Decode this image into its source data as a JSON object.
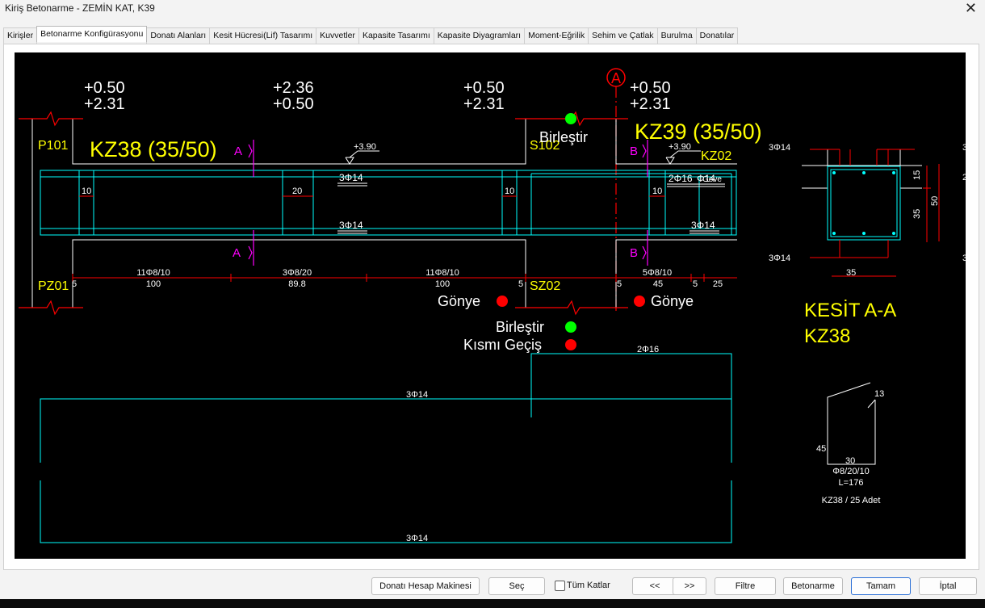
{
  "window": {
    "title": "Kiriş Betonarme - ZEMİN KAT, K39",
    "close": "✕"
  },
  "tabs": [
    {
      "label": "Kirişler"
    },
    {
      "label": "Betonarme Konfigürasyonu",
      "active": true
    },
    {
      "label": "Donatı Alanları"
    },
    {
      "label": "Kesit Hücresi(Lif) Tasarımı"
    },
    {
      "label": "Kuvvetler"
    },
    {
      "label": "Kapasite Tasarımı"
    },
    {
      "label": "Kapasite Diyagramları"
    },
    {
      "label": "Moment-Eğrilik"
    },
    {
      "label": "Sehim ve Çatlak"
    },
    {
      "label": "Burulma"
    },
    {
      "label": "Donatılar"
    }
  ],
  "drawing": {
    "elev_left": [
      "+0.50",
      "+2.31"
    ],
    "elev_mid": [
      "+2.36",
      "+0.50"
    ],
    "elev_right": [
      "+0.50",
      "+2.31"
    ],
    "elev_over": [
      "+0.50",
      "+2.31"
    ],
    "axis_a": "A",
    "beam1": "KZ38 (35/50)",
    "beam2": "KZ39 (35/50)",
    "col_p101": "P101",
    "col_s102": "S102",
    "col_kz02": "KZ02",
    "col_pz01": "PZ01",
    "col_sz02": "SZ02",
    "sec_a": "A",
    "sec_b": "B",
    "lvl1": "+3.90",
    "lvl2": "+3.90",
    "top_bar": "3Φ14",
    "bot_bar": "3Φ14",
    "right_top_bar": "2Φ16",
    "right_bot_bar": "3Φ14",
    "overlap_text": "Φ14",
    "side": "Gove",
    "dims": [
      "10",
      "20",
      "10",
      "10",
      "5",
      "5",
      "5",
      "5"
    ],
    "stirrups": [
      {
        "spec": "11Φ8/10",
        "len": "100"
      },
      {
        "spec": "3Φ8/20",
        "len": "89.8"
      },
      {
        "spec": "11Φ8/10",
        "len": "100"
      },
      {
        "spec": "5Φ8/10",
        "len": "45"
      }
    ],
    "span_end": "25",
    "birlestir": "Birleştir",
    "gonye": "Gönye",
    "kismi": "Kısmı Geçiş",
    "section_title": "KESİT A-A",
    "section_beam": "KZ38",
    "sec_top": "3Φ14",
    "sec_bot": "3Φ14",
    "sec_width": "35",
    "sec_h1": "15",
    "sec_h2": "35",
    "sec_h3": "50",
    "edge_labels": [
      "3",
      "2",
      "3"
    ],
    "long_top": "2Φ16",
    "long_mid": "3Φ14",
    "long_bot": "3Φ14",
    "stirrup_13": "13",
    "stirrup_45": "45",
    "stirrup_30": "30",
    "stirrup_spec": "Φ8/20/10",
    "stirrup_len": "L=176",
    "stirrup_count": "KZ38 / 25 Adet",
    "colors": {
      "yellow": "#ffff00",
      "cyan": "#00ffff",
      "red": "#ff0000",
      "magenta": "#ff00ff",
      "white": "#ffffff",
      "green": "#00ff00"
    }
  },
  "buttons": {
    "calc": "Donatı Hesap Makinesi",
    "select": "Seç",
    "all_floors": "Tüm Katlar",
    "prev": "<<",
    "next": ">>",
    "filter": "Filtre",
    "rc": "Betonarme",
    "ok": "Tamam",
    "cancel": "İptal"
  }
}
